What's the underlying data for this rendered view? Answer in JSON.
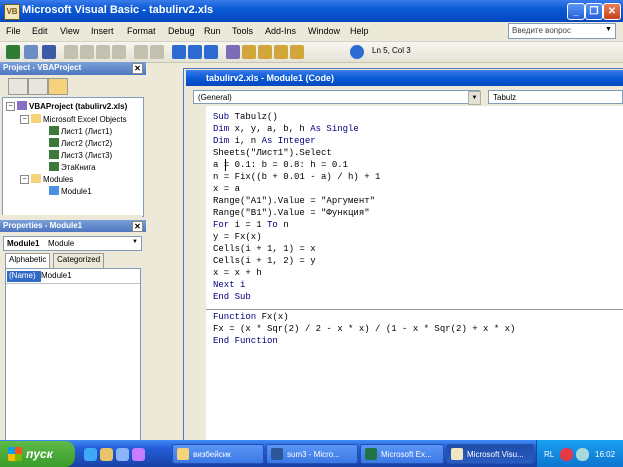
{
  "window": {
    "title": "Microsoft Visual Basic - tabulirv2.xls",
    "minimize": "_",
    "restore": "❐",
    "close": "✕"
  },
  "menu": [
    "File",
    "Edit",
    "View",
    "Insert",
    "Format",
    "Debug",
    "Run",
    "Tools",
    "Add-Ins",
    "Window",
    "Help"
  ],
  "help_search": {
    "placeholder": "Введите вопрос"
  },
  "toolbar": {
    "cursor_position": "Ln 5, Col 3"
  },
  "project": {
    "title": "Project - VBAProject",
    "tree": {
      "root": "VBAProject (tabulirv2.xls)",
      "excel_objects": "Microsoft Excel Objects",
      "sheets": [
        "Лист1 (Лист1)",
        "Лист2 (Лист2)",
        "Лист3 (Лист3)"
      ],
      "workbook": "ЭтаКнига",
      "modules_folder": "Modules",
      "module": "Module1"
    }
  },
  "properties": {
    "title": "Properties - Module1",
    "combo_name": "Module1",
    "combo_type": "Module",
    "tabs": [
      "Alphabetic",
      "Categorized"
    ],
    "row": {
      "name": "(Name)",
      "value": "Module1"
    }
  },
  "code_window": {
    "title": "tabulirv2.xls - Module1 (Code)",
    "object_combo": "(General)",
    "proc_combo": "Tabulz",
    "lines": [
      "Sub Tabulz()",
      "Dim x, y, a, b, h As Single",
      "Dim i, n As Integer",
      "Sheets(\"Лист1\").Select",
      "a = 0.1: b = 0.8: h = 0.1",
      "n = Fix((b + 0.01 - a) / h) + 1",
      "x = a",
      "Range(\"A1\").Value = \"Аргумент\"",
      "Range(\"B1\").Value = \"Функция\"",
      "For i = 1 To n",
      "y = Fx(x)",
      "Cells(i + 1, 1) = x",
      "Cells(i + 1, 2) = y",
      "x = x + h",
      "Next i",
      "End Sub",
      "Function Fx(x)",
      "Fx = (x * Sqr(2) / 2 - x * x) / (1 - x * Sqr(2) + x * x)",
      "End Function"
    ]
  },
  "taskbar": {
    "start": "пуск",
    "tasks": [
      "визбейсик",
      "sum3 - Micro...",
      "Microsoft Ex...",
      "Microsoft Visu..."
    ],
    "lang": "RL",
    "clock": "16:02"
  }
}
